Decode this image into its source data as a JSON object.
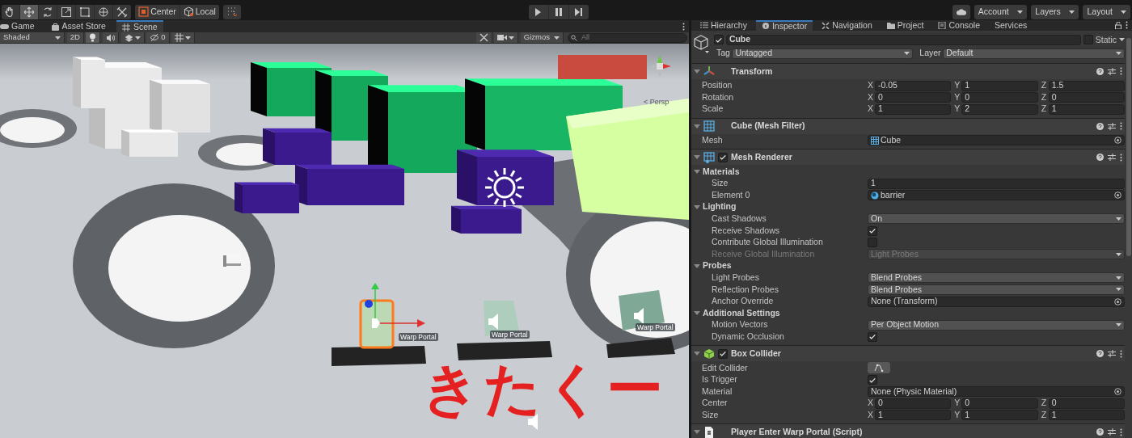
{
  "toolbar": {
    "tools": [
      {
        "kind": "hand",
        "selected": false
      },
      {
        "kind": "move",
        "selected": true
      },
      {
        "kind": "rotate",
        "selected": false
      },
      {
        "kind": "scale",
        "selected": false
      },
      {
        "kind": "rect",
        "selected": false
      },
      {
        "kind": "transform",
        "selected": false
      },
      {
        "kind": "custom",
        "selected": false
      }
    ],
    "pivot_buttons": [
      "Center",
      "Local"
    ],
    "right_buttons": [
      "Account",
      "Layers",
      "Layout"
    ]
  },
  "left_tabs": [
    {
      "label": "Game",
      "selected": false
    },
    {
      "label": "Asset Store",
      "selected": false
    },
    {
      "label": "Scene",
      "selected": true
    }
  ],
  "scene_toolbar": {
    "lighting_on": true,
    "audio_on": false,
    "tools_on": false,
    "shading": "Shaded",
    "mode_2d": "2D",
    "hidden_count": "0",
    "gizmos": "Gizmos",
    "search": {
      "placeholder": "All"
    }
  },
  "scene": {
    "labels": [
      "Warp Portal",
      "Warp Portal",
      "Warp Portal"
    ],
    "camera_mode": "< Persp",
    "annotation": "きたくー"
  },
  "right_tabs": [
    {
      "label": "Hierarchy",
      "selected": false
    },
    {
      "label": "Inspector",
      "selected": true
    },
    {
      "label": "Navigation",
      "selected": false
    },
    {
      "label": "Project",
      "selected": false
    },
    {
      "label": "Console",
      "selected": false
    },
    {
      "label": "Services",
      "selected": false
    }
  ],
  "inspector": {
    "object": {
      "active": true,
      "name": "Cube",
      "static": false,
      "static_label": "Static",
      "tag_label": "Tag",
      "tag": "Untagged",
      "layer_label": "Layer",
      "layer": "Default"
    },
    "components": [
      {
        "kind": "transform",
        "title": "Transform",
        "expanded": true,
        "rows": [
          {
            "kind": "vector",
            "label": "Position",
            "disabled": false,
            "fields": [
              {
                "axis": "X",
                "value": "-0.05"
              },
              {
                "axis": "Y",
                "value": "1"
              },
              {
                "axis": "Z",
                "value": "1.5"
              }
            ]
          },
          {
            "kind": "vector",
            "label": "Rotation",
            "disabled": false,
            "fields": [
              {
                "axis": "X",
                "value": "0"
              },
              {
                "axis": "Y",
                "value": "0"
              },
              {
                "axis": "Z",
                "value": "0"
              }
            ]
          },
          {
            "kind": "vector",
            "label": "Scale",
            "disabled": false,
            "fields": [
              {
                "axis": "X",
                "value": "1"
              },
              {
                "axis": "Y",
                "value": "2"
              },
              {
                "axis": "Z",
                "value": "1"
              }
            ]
          }
        ]
      },
      {
        "kind": "mesh",
        "title": "Cube (Mesh Filter)",
        "expanded": true,
        "rows": [
          {
            "kind": "mesh_object",
            "label": "Mesh",
            "value": "Cube",
            "disabled": false
          }
        ]
      },
      {
        "kind": "renderer",
        "title": "Mesh Renderer",
        "enabled": true,
        "expanded": true,
        "rows": [
          {
            "kind": "section",
            "label": "Materials",
            "expanded": true,
            "children": [
              {
                "kind": "text",
                "label": "Size",
                "value": "1",
                "disabled": false
              },
              {
                "kind": "material_object",
                "label": "Element 0",
                "value": "barrier",
                "disabled": false
              }
            ]
          },
          {
            "kind": "section",
            "label": "Lighting",
            "expanded": true,
            "children": [
              {
                "kind": "dropdown",
                "label": "Cast Shadows",
                "value": "On",
                "disabled": false
              },
              {
                "kind": "checkbox",
                "label": "Receive Shadows",
                "checked": true,
                "disabled": false
              },
              {
                "kind": "checkbox",
                "label": "Contribute Global Illumination",
                "checked": false,
                "disabled": false
              },
              {
                "kind": "dropdown",
                "label": "Receive Global Illumination",
                "value": "Light Probes",
                "disabled": true
              }
            ]
          },
          {
            "kind": "section",
            "label": "Probes",
            "expanded": true,
            "children": [
              {
                "kind": "dropdown",
                "label": "Light Probes",
                "value": "Blend Probes",
                "disabled": false
              },
              {
                "kind": "dropdown",
                "label": "Reflection Probes",
                "value": "Blend Probes",
                "disabled": false
              },
              {
                "kind": "object",
                "label": "Anchor Override",
                "value": "None (Transform)",
                "disabled": false
              }
            ]
          },
          {
            "kind": "section",
            "label": "Additional Settings",
            "expanded": true,
            "children": [
              {
                "kind": "dropdown",
                "label": "Motion Vectors",
                "value": "Per Object Motion",
                "disabled": false
              },
              {
                "kind": "checkbox",
                "label": "Dynamic Occlusion",
                "checked": true,
                "disabled": false
              }
            ]
          }
        ]
      },
      {
        "kind": "collider",
        "title": "Box Collider",
        "enabled": true,
        "expanded": true,
        "rows": [
          {
            "kind": "button",
            "label": "Edit Collider",
            "disabled": false
          },
          {
            "kind": "checkbox",
            "label": "Is Trigger",
            "checked": true,
            "disabled": false
          },
          {
            "kind": "object",
            "label": "Material",
            "value": "None (Physic Material)",
            "disabled": false
          },
          {
            "kind": "vector",
            "label": "Center",
            "disabled": false,
            "fields": [
              {
                "axis": "X",
                "value": "0"
              },
              {
                "axis": "Y",
                "value": "0"
              },
              {
                "axis": "Z",
                "value": "0"
              }
            ]
          },
          {
            "kind": "vector",
            "label": "Size",
            "disabled": false,
            "fields": [
              {
                "axis": "X",
                "value": "1"
              },
              {
                "axis": "Y",
                "value": "1"
              },
              {
                "axis": "Z",
                "value": "1"
              }
            ]
          }
        ]
      },
      {
        "kind": "script",
        "title": "Player Enter Warp Portal (Script)",
        "expanded": true
      }
    ]
  }
}
